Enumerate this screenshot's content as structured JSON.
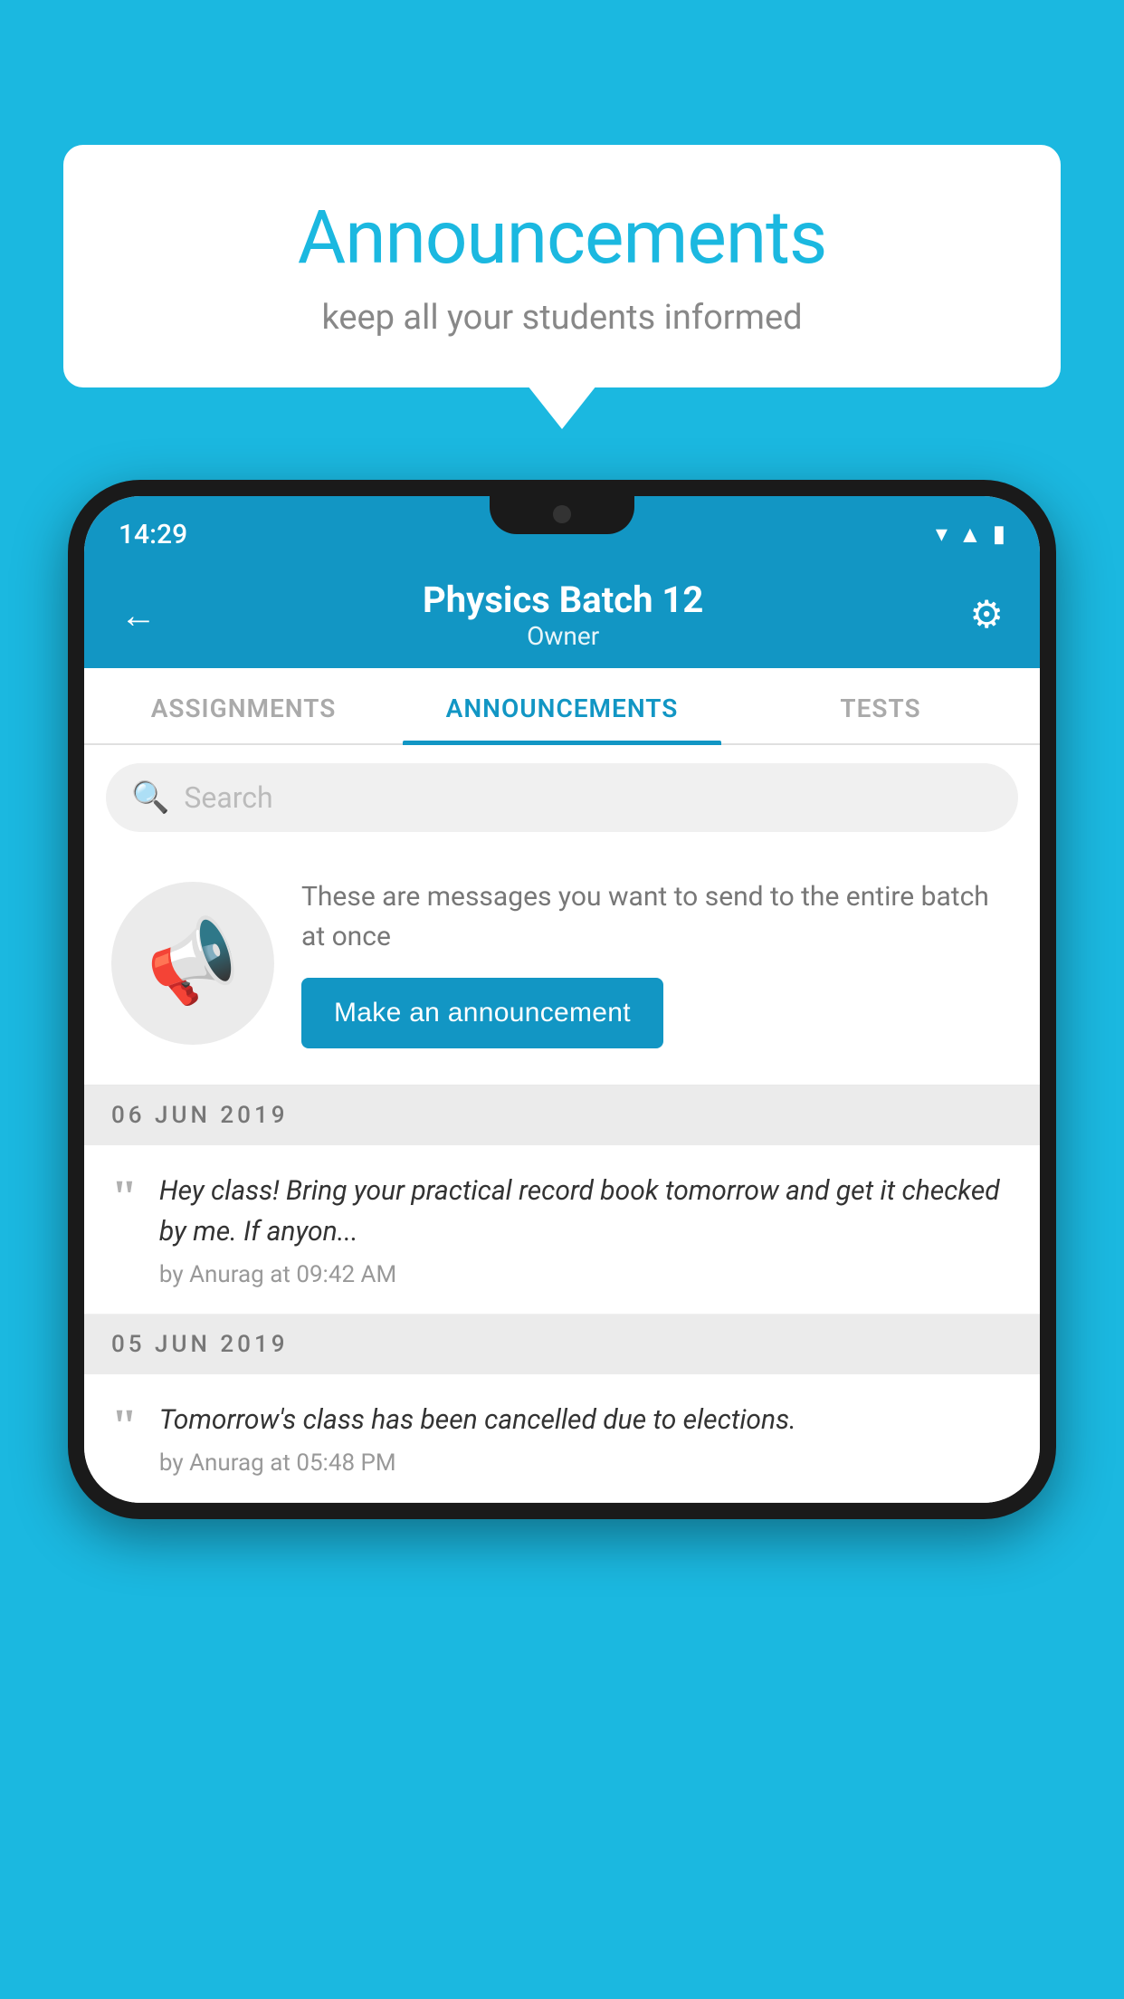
{
  "background_color": "#1bb8e0",
  "speech_bubble": {
    "title": "Announcements",
    "subtitle": "keep all your students informed"
  },
  "phone": {
    "status_bar": {
      "time": "14:29",
      "icons": [
        "wifi",
        "signal",
        "battery"
      ]
    },
    "header": {
      "title": "Physics Batch 12",
      "subtitle": "Owner",
      "back_label": "←",
      "gear_label": "⚙"
    },
    "tabs": [
      {
        "label": "ASSIGNMENTS",
        "active": false
      },
      {
        "label": "ANNOUNCEMENTS",
        "active": true
      },
      {
        "label": "TESTS",
        "active": false
      }
    ],
    "search": {
      "placeholder": "Search"
    },
    "promo": {
      "description_text": "These are messages you want to send to the entire batch at once",
      "button_label": "Make an announcement"
    },
    "announcements": [
      {
        "date": "06  JUN  2019",
        "text": "Hey class! Bring your practical record book tomorrow and get it checked by me. If anyon...",
        "meta": "by Anurag at 09:42 AM"
      },
      {
        "date": "05  JUN  2019",
        "text": "Tomorrow's class has been cancelled due to elections.",
        "meta": "by Anurag at 05:48 PM"
      }
    ]
  }
}
